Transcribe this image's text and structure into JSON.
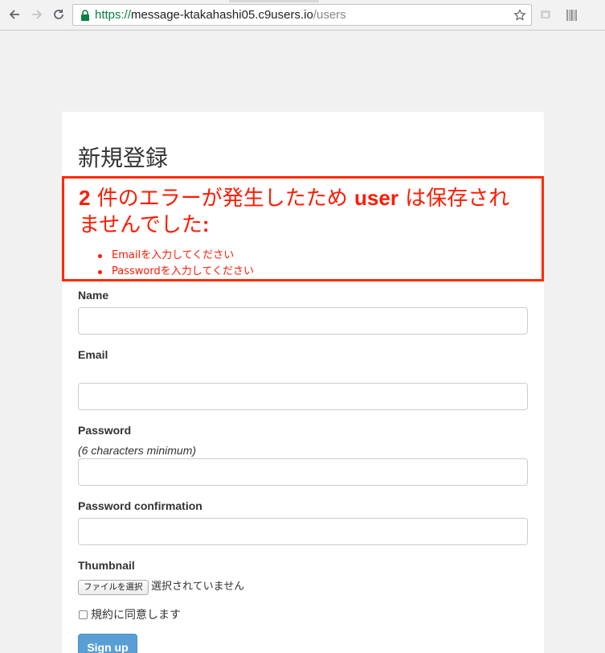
{
  "browser": {
    "url_scheme": "https://",
    "url_host": "message-ktakahashi05.c9users.io",
    "url_path": "/users"
  },
  "form": {
    "title": "新規登録",
    "errors": {
      "count": "2",
      "heading_mid": "件のエラーが発生したため",
      "model": "user",
      "heading_tail": "は保存されませんでした",
      "colon": ":",
      "items": [
        "Emailを入力してください",
        "Passwordを入力してください"
      ]
    },
    "fields": {
      "name_label": "Name",
      "name_value": "",
      "email_label": "Email",
      "email_value": "",
      "password_label": "Password",
      "password_help": "(6 characters minimum)",
      "password_value": "",
      "password_confirmation_label": "Password confirmation",
      "password_confirmation_value": "",
      "thumbnail_label": "Thumbnail",
      "file_button": "ファイルを選択",
      "file_status": "選択されていません",
      "terms_label": "規約に同意します"
    },
    "submit_label": "Sign up"
  },
  "colors": {
    "error": "#ff1a00",
    "button": "#5a9fd4",
    "background": "#f1f1f1"
  }
}
